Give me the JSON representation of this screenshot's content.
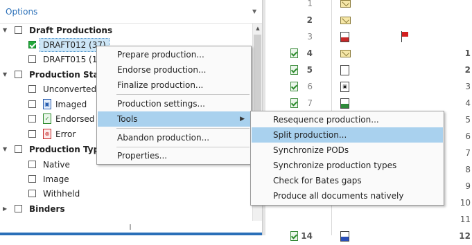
{
  "options": {
    "label": "Options"
  },
  "tree": {
    "draft_productions": {
      "label": "Draft Productions"
    },
    "draft012": {
      "label": "DRAFT012 (37)"
    },
    "draft015": {
      "label": "DRAFT015 (1"
    },
    "production_status": {
      "label": "Production Sta"
    },
    "unconverted": {
      "label": "Unconverted"
    },
    "imaged": {
      "label": "Imaged"
    },
    "endorsed": {
      "label": "Endorsed"
    },
    "error": {
      "label": "Error"
    },
    "production_type": {
      "label": "Production Typ"
    },
    "native": {
      "label": "Native"
    },
    "image": {
      "label": "Image"
    },
    "withheld": {
      "label": "Withheld"
    },
    "binders": {
      "label": "Binders"
    }
  },
  "grid": {
    "rows": [
      {
        "num": "1",
        "bold": false,
        "checked": false,
        "doc": "env",
        "flag": false,
        "count": ""
      },
      {
        "num": "2",
        "bold": true,
        "checked": false,
        "doc": "env",
        "flag": false,
        "count": ""
      },
      {
        "num": "3",
        "bold": false,
        "checked": false,
        "doc": "red",
        "flag": true,
        "count": ""
      },
      {
        "num": "4",
        "bold": true,
        "checked": true,
        "doc": "env",
        "flag": false,
        "count": "1"
      },
      {
        "num": "5",
        "bold": true,
        "checked": true,
        "doc": "page",
        "flag": false,
        "count": "2"
      },
      {
        "num": "6",
        "bold": false,
        "checked": true,
        "doc": "img",
        "flag": false,
        "count": "3"
      },
      {
        "num": "7",
        "bold": false,
        "checked": true,
        "doc": "green",
        "flag": false,
        "count": "4"
      },
      {
        "num": "",
        "bold": false,
        "checked": false,
        "doc": "",
        "flag": false,
        "count": "5"
      },
      {
        "num": "",
        "bold": false,
        "checked": false,
        "doc": "",
        "flag": false,
        "count": "6"
      },
      {
        "num": "",
        "bold": false,
        "checked": false,
        "doc": "",
        "flag": false,
        "count": "7"
      },
      {
        "num": "",
        "bold": false,
        "checked": false,
        "doc": "",
        "flag": false,
        "count": "8"
      },
      {
        "num": "",
        "bold": false,
        "checked": false,
        "doc": "",
        "flag": false,
        "count": "9"
      },
      {
        "num": "",
        "bold": false,
        "checked": false,
        "doc": "",
        "flag": false,
        "count": "10"
      },
      {
        "num": "",
        "bold": false,
        "checked": false,
        "doc": "",
        "flag": false,
        "count": "11"
      },
      {
        "num": "14",
        "bold": true,
        "checked": true,
        "doc": "blue",
        "flag": false,
        "count": "12"
      }
    ]
  },
  "menu_main": {
    "items": [
      {
        "label": "Prepare production..."
      },
      {
        "label": "Endorse production..."
      },
      {
        "label": "Finalize production..."
      },
      {
        "label": "Production settings..."
      },
      {
        "label": "Tools"
      },
      {
        "label": "Abandon production..."
      },
      {
        "label": "Properties..."
      }
    ]
  },
  "menu_tools": {
    "items": [
      {
        "label": "Resequence production..."
      },
      {
        "label": "Split production..."
      },
      {
        "label": "Synchronize PODs"
      },
      {
        "label": "Synchronize production types"
      },
      {
        "label": "Check for Bates gaps"
      },
      {
        "label": "Produce all documents natively"
      }
    ]
  },
  "colors": {
    "accent": "#2a6fb8",
    "highlight": "#a9d1ee",
    "check_green": "#22a83a"
  }
}
